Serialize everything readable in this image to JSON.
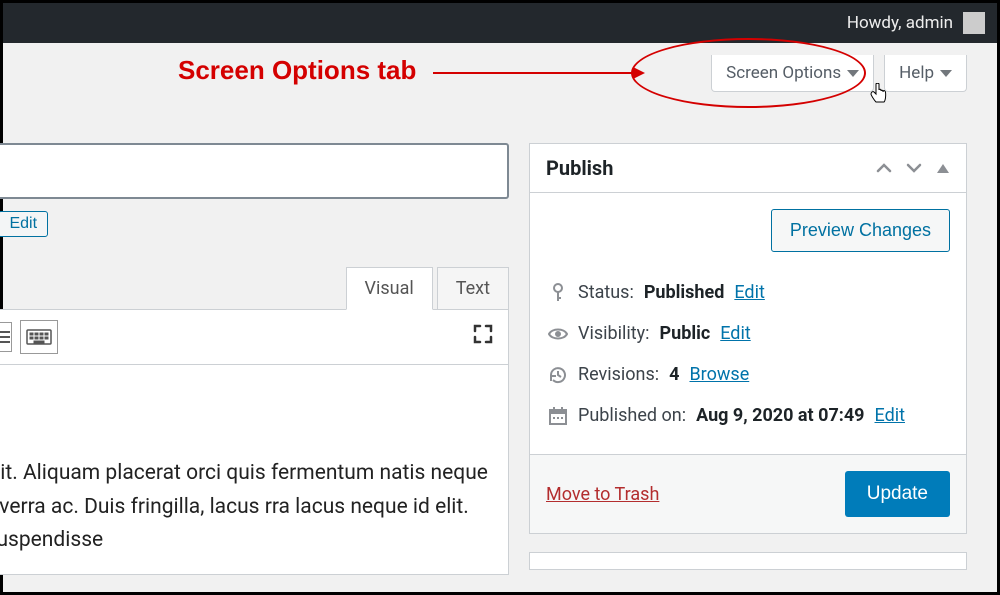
{
  "adminbar": {
    "greeting": "Howdy, admin"
  },
  "tabs": {
    "screen_options": "Screen Options",
    "help": "Help"
  },
  "annotation": {
    "label": "Screen Options tab"
  },
  "permalink": {
    "trail": "/",
    "edit": "Edit"
  },
  "editor": {
    "tab_visual": "Visual",
    "tab_text": "Text",
    "body": "elit. Aliquam placerat orci quis fermentum natis neque viverra ac. Duis fringilla, lacus rra lacus neque id elit. Suspendisse"
  },
  "publish": {
    "title": "Publish",
    "preview_btn": "Preview Changes",
    "status_label": "Status:",
    "status_value": "Published",
    "status_edit": "Edit",
    "visibility_label": "Visibility:",
    "visibility_value": "Public",
    "visibility_edit": "Edit",
    "revisions_label": "Revisions:",
    "revisions_value": "4",
    "revisions_browse": "Browse",
    "published_label": "Published on:",
    "published_value": "Aug 9, 2020 at 07:49",
    "published_edit": "Edit",
    "trash": "Move to Trash",
    "update": "Update"
  }
}
